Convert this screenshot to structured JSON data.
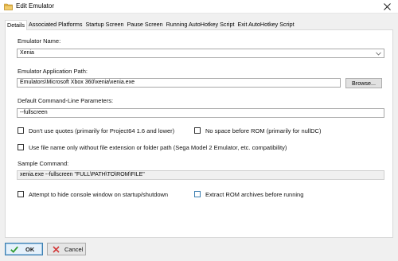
{
  "window": {
    "title": "Edit Emulator",
    "app_icon": "folder-icon",
    "close_icon": "close-icon"
  },
  "tabs": [
    {
      "label": "Details",
      "active": true
    },
    {
      "label": "Associated Platforms",
      "active": false
    },
    {
      "label": "Startup Screen",
      "active": false
    },
    {
      "label": "Pause Screen",
      "active": false
    },
    {
      "label": "Running AutoHotkey Script",
      "active": false
    },
    {
      "label": "Exit AutoHotkey Script",
      "active": false
    }
  ],
  "details": {
    "emulator_name_label": "Emulator Name:",
    "emulator_name_value": "Xenia",
    "app_path_label": "Emulator Application Path:",
    "app_path_value": "Emulators\\Microsoft Xbox 360\\xenia\\xenia.exe",
    "browse_label": "Browse...",
    "cmd_params_label": "Default Command-Line Parameters:",
    "cmd_params_value": "--fullscreen",
    "options": {
      "dont_use_quotes": {
        "label": "Don't use quotes (primarily for Project64 1.6 and lower)",
        "checked": false
      },
      "no_space_before_rom": {
        "label": "No space before ROM (primarily for nullDC)",
        "checked": false
      },
      "file_name_only": {
        "label": "Use file name only without file extension or folder path (Sega Model 2 Emulator, etc. compatibility)",
        "checked": false
      },
      "hide_console": {
        "label": "Attempt to hide console window on startup/shutdown",
        "checked": false
      },
      "extract_rom": {
        "label": "Extract ROM archives before running",
        "checked": false
      }
    },
    "sample_command_label": "Sample Command:",
    "sample_command_value": "xenia.exe --fullscreen \"FULL\\PATH\\TO\\ROM\\FILE\""
  },
  "footer": {
    "ok_label": "OK",
    "ok_icon": "checkmark-icon",
    "cancel_label": "Cancel",
    "cancel_icon": "x-icon"
  },
  "colors": {
    "accent": "#3c7fb1",
    "ok_check": "#2e9b2e",
    "cancel_x": "#d23a3a",
    "folder": "#e8b84a"
  }
}
